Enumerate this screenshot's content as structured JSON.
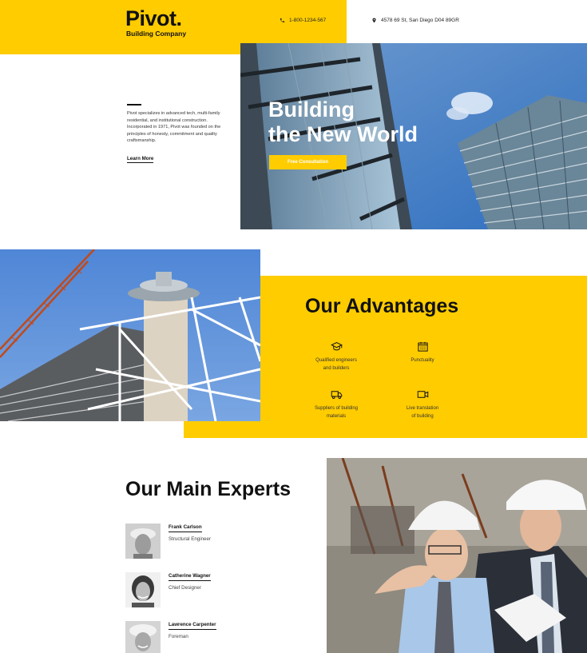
{
  "brand": {
    "name": "Pivot.",
    "tagline": "Building Company"
  },
  "header": {
    "phone": "1-800-1234-567",
    "address": "4578 69 St, San Diego D04 89GR"
  },
  "hero": {
    "title_line1": "Building",
    "title_line2": "the New World",
    "cta_label": "Free Consultation",
    "intro_text": "Pivot specializes in advanced tech, multi-family residential, and institutional construction. Incorporated in 1971, Pivot was founded on the principles of honesty, commitment and quality craftsmanship.",
    "learn_more_label": "Learn More"
  },
  "advantages": {
    "title": "Our Advantages",
    "items": [
      {
        "label_line1": "Qualified engineers",
        "label_line2": "and builders",
        "icon": "graduation-cap-icon"
      },
      {
        "label_line1": "Punctuality",
        "label_line2": "",
        "icon": "calendar-icon"
      },
      {
        "label_line1": "Suppliers of building",
        "label_line2": "materials",
        "icon": "truck-icon"
      },
      {
        "label_line1": "Live translation",
        "label_line2": "of building",
        "icon": "video-camera-icon"
      }
    ]
  },
  "experts": {
    "title": "Our Main Experts",
    "people": [
      {
        "name": "Frank Carlson",
        "role": "Structural Engineer"
      },
      {
        "name": "Catherine Wagner",
        "role": "Chief Designer"
      },
      {
        "name": "Lawrence Carpenter",
        "role": "Foreman"
      }
    ]
  },
  "colors": {
    "accent": "#ffcc00",
    "text": "#111111"
  }
}
